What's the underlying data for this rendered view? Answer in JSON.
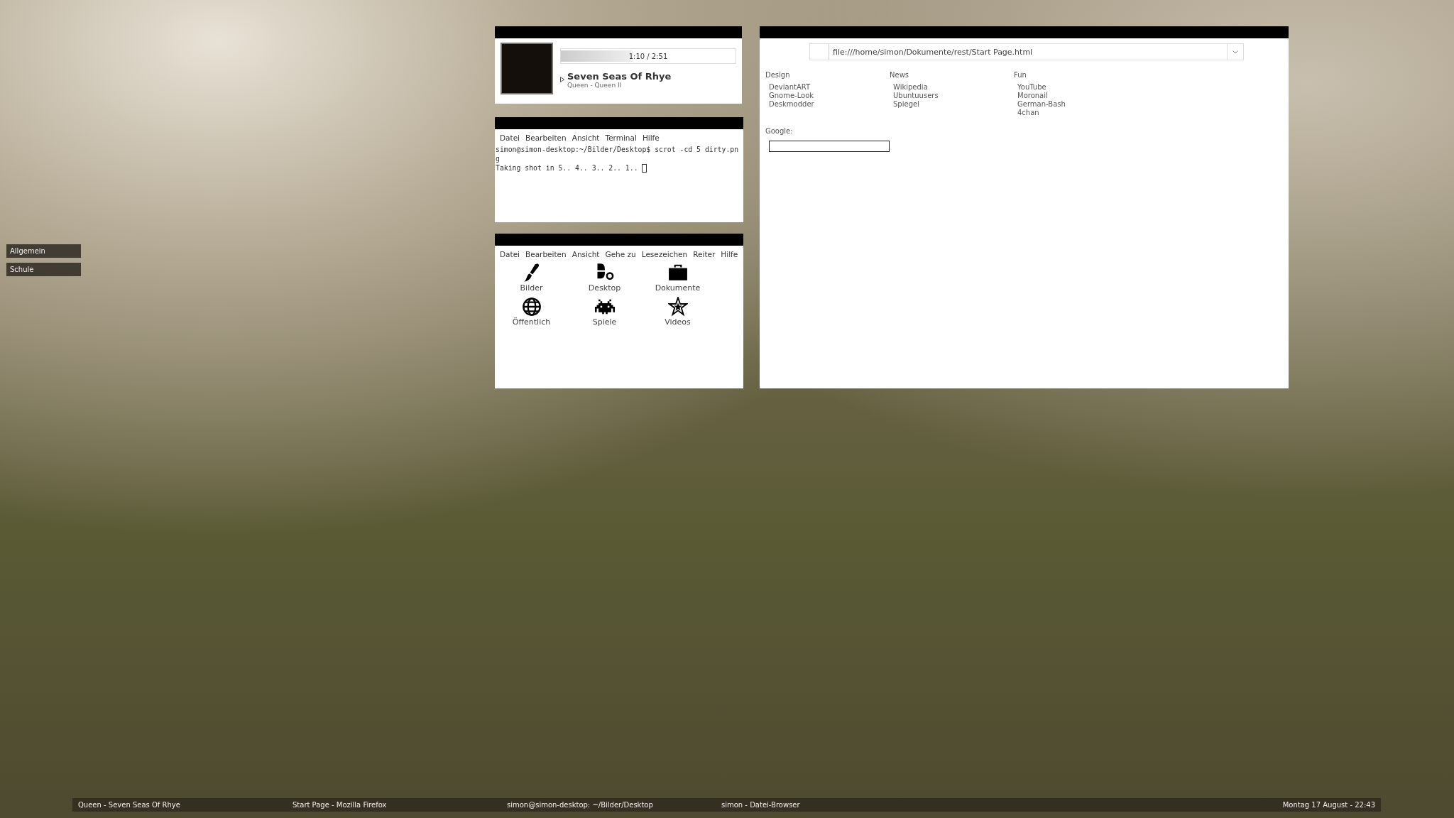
{
  "sidebar": {
    "items": [
      {
        "label": "Allgemein"
      },
      {
        "label": "Schule"
      }
    ]
  },
  "music_player": {
    "progress": {
      "level": 0.41,
      "time": "1:10 / 2:51"
    },
    "title": "Seven Seas Of Rhye",
    "subtitle": "Queen - Queen II"
  },
  "terminal": {
    "menu": [
      "Datei",
      "Bearbeiten",
      "Ansicht",
      "Terminal",
      "Hilfe"
    ],
    "lines": [
      "simon@simon-desktop:~/Bilder/Desktop$ scrot -cd 5 dirty.pn",
      "g",
      "Taking shot in 5.. 4.. 3.. 2.. 1.. "
    ]
  },
  "file_browser": {
    "menu": [
      "Datei",
      "Bearbeiten",
      "Ansicht",
      "Gehe zu",
      "Lesezeichen",
      "Reiter",
      "Hilfe"
    ],
    "folders": [
      "Bilder",
      "Desktop",
      "Dokumente",
      "Öffentlich",
      "Spiele",
      "Videos"
    ]
  },
  "browser": {
    "address": "file:///home/simon/Dokumente/rest/Start Page.html",
    "columns": [
      {
        "heading": "Design",
        "links": [
          "DeviantART",
          "Gnome-Look",
          "Deskmodder"
        ]
      },
      {
        "heading": "News",
        "links": [
          "Wikipedia",
          "Ubuntuusers",
          "Spiegel"
        ]
      },
      {
        "heading": "Fun",
        "links": [
          "YouTube",
          "Moronail",
          "German-Bash",
          "4chan"
        ]
      }
    ],
    "search_label": "Google:"
  },
  "taskbar": {
    "tasks": [
      "Queen - Seven Seas Of Rhye",
      "Start Page - Mozilla Firefox",
      "simon@simon-desktop: ~/Bilder/Desktop",
      "simon - Datei-Browser"
    ],
    "clock": "Montag 17 August - 22:43"
  }
}
